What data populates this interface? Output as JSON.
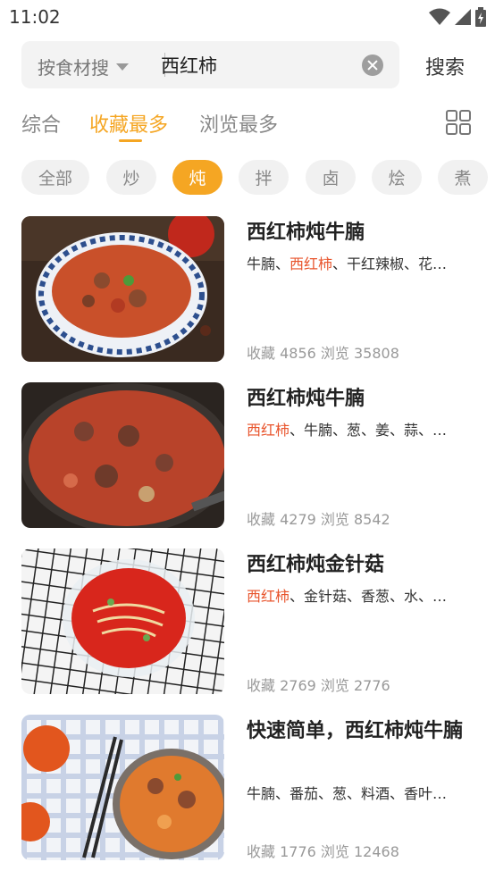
{
  "status_bar": {
    "time": "11:02",
    "icons": [
      "wifi-icon",
      "signal-icon",
      "battery-charging-icon"
    ]
  },
  "search": {
    "type_label": "按食材搜",
    "query": "西红柿",
    "button_label": "搜索"
  },
  "sort_tabs": [
    {
      "label": "综合",
      "active": false
    },
    {
      "label": "收藏最多",
      "active": true
    },
    {
      "label": "浏览最多",
      "active": false
    }
  ],
  "filters": [
    {
      "label": "全部",
      "active": false
    },
    {
      "label": "炒",
      "active": false
    },
    {
      "label": "炖",
      "active": true
    },
    {
      "label": "拌",
      "active": false
    },
    {
      "label": "卤",
      "active": false
    },
    {
      "label": "烩",
      "active": false
    },
    {
      "label": "煮",
      "active": false
    }
  ],
  "recipes": [
    {
      "title": "西红柿炖牛腩",
      "ingredients": {
        "pre": "牛腩、",
        "hl": "西红柿",
        "post": "、干红辣椒、花…"
      },
      "stats": "收藏 4856 浏览 35808",
      "image": "beef-brisket-tomato-bowl"
    },
    {
      "title": "西红柿炖牛腩",
      "ingredients": {
        "pre": "",
        "hl": "西红柿",
        "post": "、牛腩、葱、姜、蒜、…"
      },
      "stats": "收藏 4279 浏览 8542",
      "image": "beef-brisket-tomato-pot"
    },
    {
      "title": "西红柿炖金针菇",
      "ingredients": {
        "pre": "",
        "hl": "西红柿",
        "post": "、金针菇、香葱、水、…"
      },
      "stats": "收藏 2769 浏览 2776",
      "image": "enoki-tomato-soup"
    },
    {
      "title": "快速简单，西红柿炖牛腩",
      "ingredients": {
        "pre": "牛腩、番茄、葱、料酒、香叶…",
        "hl": "",
        "post": ""
      },
      "stats": "收藏 1776 浏览 12468",
      "image": "beef-tomato-pot-chopsticks"
    }
  ],
  "colors": {
    "accent": "#f5a623",
    "highlight": "#e8542c",
    "chip_bg": "#f1f1f1"
  }
}
